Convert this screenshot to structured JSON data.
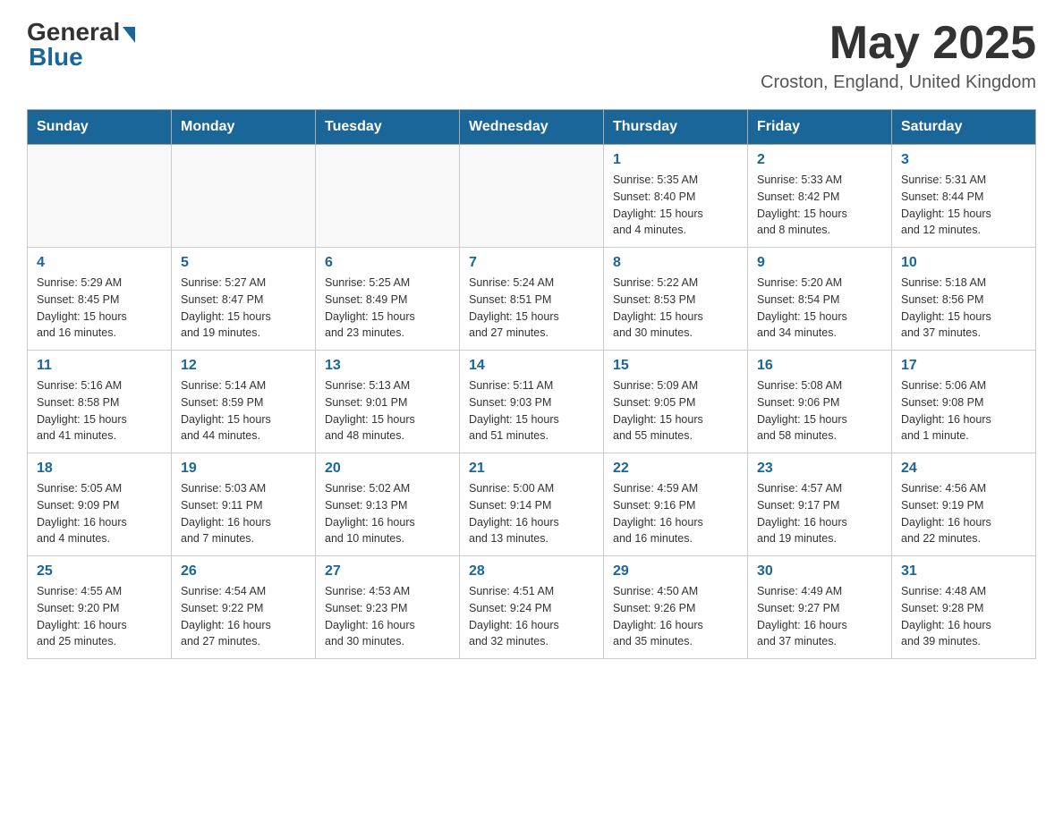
{
  "header": {
    "logo_general": "General",
    "logo_blue": "Blue",
    "title": "May 2025",
    "subtitle": "Croston, England, United Kingdom"
  },
  "days_of_week": [
    "Sunday",
    "Monday",
    "Tuesday",
    "Wednesday",
    "Thursday",
    "Friday",
    "Saturday"
  ],
  "weeks": [
    {
      "days": [
        {
          "num": "",
          "info": ""
        },
        {
          "num": "",
          "info": ""
        },
        {
          "num": "",
          "info": ""
        },
        {
          "num": "",
          "info": ""
        },
        {
          "num": "1",
          "info": "Sunrise: 5:35 AM\nSunset: 8:40 PM\nDaylight: 15 hours\nand 4 minutes."
        },
        {
          "num": "2",
          "info": "Sunrise: 5:33 AM\nSunset: 8:42 PM\nDaylight: 15 hours\nand 8 minutes."
        },
        {
          "num": "3",
          "info": "Sunrise: 5:31 AM\nSunset: 8:44 PM\nDaylight: 15 hours\nand 12 minutes."
        }
      ]
    },
    {
      "days": [
        {
          "num": "4",
          "info": "Sunrise: 5:29 AM\nSunset: 8:45 PM\nDaylight: 15 hours\nand 16 minutes."
        },
        {
          "num": "5",
          "info": "Sunrise: 5:27 AM\nSunset: 8:47 PM\nDaylight: 15 hours\nand 19 minutes."
        },
        {
          "num": "6",
          "info": "Sunrise: 5:25 AM\nSunset: 8:49 PM\nDaylight: 15 hours\nand 23 minutes."
        },
        {
          "num": "7",
          "info": "Sunrise: 5:24 AM\nSunset: 8:51 PM\nDaylight: 15 hours\nand 27 minutes."
        },
        {
          "num": "8",
          "info": "Sunrise: 5:22 AM\nSunset: 8:53 PM\nDaylight: 15 hours\nand 30 minutes."
        },
        {
          "num": "9",
          "info": "Sunrise: 5:20 AM\nSunset: 8:54 PM\nDaylight: 15 hours\nand 34 minutes."
        },
        {
          "num": "10",
          "info": "Sunrise: 5:18 AM\nSunset: 8:56 PM\nDaylight: 15 hours\nand 37 minutes."
        }
      ]
    },
    {
      "days": [
        {
          "num": "11",
          "info": "Sunrise: 5:16 AM\nSunset: 8:58 PM\nDaylight: 15 hours\nand 41 minutes."
        },
        {
          "num": "12",
          "info": "Sunrise: 5:14 AM\nSunset: 8:59 PM\nDaylight: 15 hours\nand 44 minutes."
        },
        {
          "num": "13",
          "info": "Sunrise: 5:13 AM\nSunset: 9:01 PM\nDaylight: 15 hours\nand 48 minutes."
        },
        {
          "num": "14",
          "info": "Sunrise: 5:11 AM\nSunset: 9:03 PM\nDaylight: 15 hours\nand 51 minutes."
        },
        {
          "num": "15",
          "info": "Sunrise: 5:09 AM\nSunset: 9:05 PM\nDaylight: 15 hours\nand 55 minutes."
        },
        {
          "num": "16",
          "info": "Sunrise: 5:08 AM\nSunset: 9:06 PM\nDaylight: 15 hours\nand 58 minutes."
        },
        {
          "num": "17",
          "info": "Sunrise: 5:06 AM\nSunset: 9:08 PM\nDaylight: 16 hours\nand 1 minute."
        }
      ]
    },
    {
      "days": [
        {
          "num": "18",
          "info": "Sunrise: 5:05 AM\nSunset: 9:09 PM\nDaylight: 16 hours\nand 4 minutes."
        },
        {
          "num": "19",
          "info": "Sunrise: 5:03 AM\nSunset: 9:11 PM\nDaylight: 16 hours\nand 7 minutes."
        },
        {
          "num": "20",
          "info": "Sunrise: 5:02 AM\nSunset: 9:13 PM\nDaylight: 16 hours\nand 10 minutes."
        },
        {
          "num": "21",
          "info": "Sunrise: 5:00 AM\nSunset: 9:14 PM\nDaylight: 16 hours\nand 13 minutes."
        },
        {
          "num": "22",
          "info": "Sunrise: 4:59 AM\nSunset: 9:16 PM\nDaylight: 16 hours\nand 16 minutes."
        },
        {
          "num": "23",
          "info": "Sunrise: 4:57 AM\nSunset: 9:17 PM\nDaylight: 16 hours\nand 19 minutes."
        },
        {
          "num": "24",
          "info": "Sunrise: 4:56 AM\nSunset: 9:19 PM\nDaylight: 16 hours\nand 22 minutes."
        }
      ]
    },
    {
      "days": [
        {
          "num": "25",
          "info": "Sunrise: 4:55 AM\nSunset: 9:20 PM\nDaylight: 16 hours\nand 25 minutes."
        },
        {
          "num": "26",
          "info": "Sunrise: 4:54 AM\nSunset: 9:22 PM\nDaylight: 16 hours\nand 27 minutes."
        },
        {
          "num": "27",
          "info": "Sunrise: 4:53 AM\nSunset: 9:23 PM\nDaylight: 16 hours\nand 30 minutes."
        },
        {
          "num": "28",
          "info": "Sunrise: 4:51 AM\nSunset: 9:24 PM\nDaylight: 16 hours\nand 32 minutes."
        },
        {
          "num": "29",
          "info": "Sunrise: 4:50 AM\nSunset: 9:26 PM\nDaylight: 16 hours\nand 35 minutes."
        },
        {
          "num": "30",
          "info": "Sunrise: 4:49 AM\nSunset: 9:27 PM\nDaylight: 16 hours\nand 37 minutes."
        },
        {
          "num": "31",
          "info": "Sunrise: 4:48 AM\nSunset: 9:28 PM\nDaylight: 16 hours\nand 39 minutes."
        }
      ]
    }
  ]
}
